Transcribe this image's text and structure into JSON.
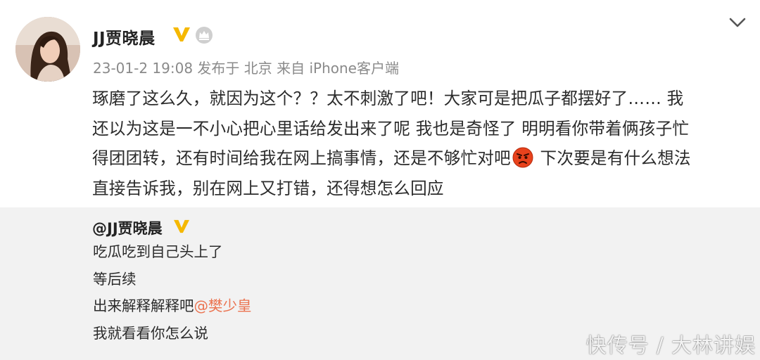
{
  "post": {
    "username": "JJ贾晓晨",
    "meta": "23-01-2 19:08 发布于 北京 来自 iPhone客户端",
    "body_lines": [
      "琢磨了这么久，就因为这个？？太不刺激了吧！大家可是把瓜子都摆好了…… 我",
      "还以为这是一不小心把心里话给发出来了呢 我也是奇怪了 明明看你带着俩孩子忙",
      "得团团转，还有时间给我在网上搞事情，还是不够忙对吧",
      "下次要是有什么想法",
      "直接告诉我，别在网上又打错，还得想怎么回应"
    ],
    "icons": {
      "verified": "verified-v-icon",
      "crown": "crown-icon",
      "emoji": "angry-face-emoji-icon",
      "menu": "chevron-down-icon"
    }
  },
  "repost": {
    "username": "@JJ贾晓晨",
    "lines": [
      "吃瓜吃到自己头上了",
      "等后续",
      "出来解释解释吧",
      "我就看看你怎么说"
    ],
    "mention": "@樊少皇"
  },
  "watermark": "快传号 / 大林讲娱",
  "colors": {
    "verified": "#f5b800",
    "mention": "#eb7350",
    "meta": "#8a8a8a",
    "repost_bg": "#f2f2f2"
  }
}
